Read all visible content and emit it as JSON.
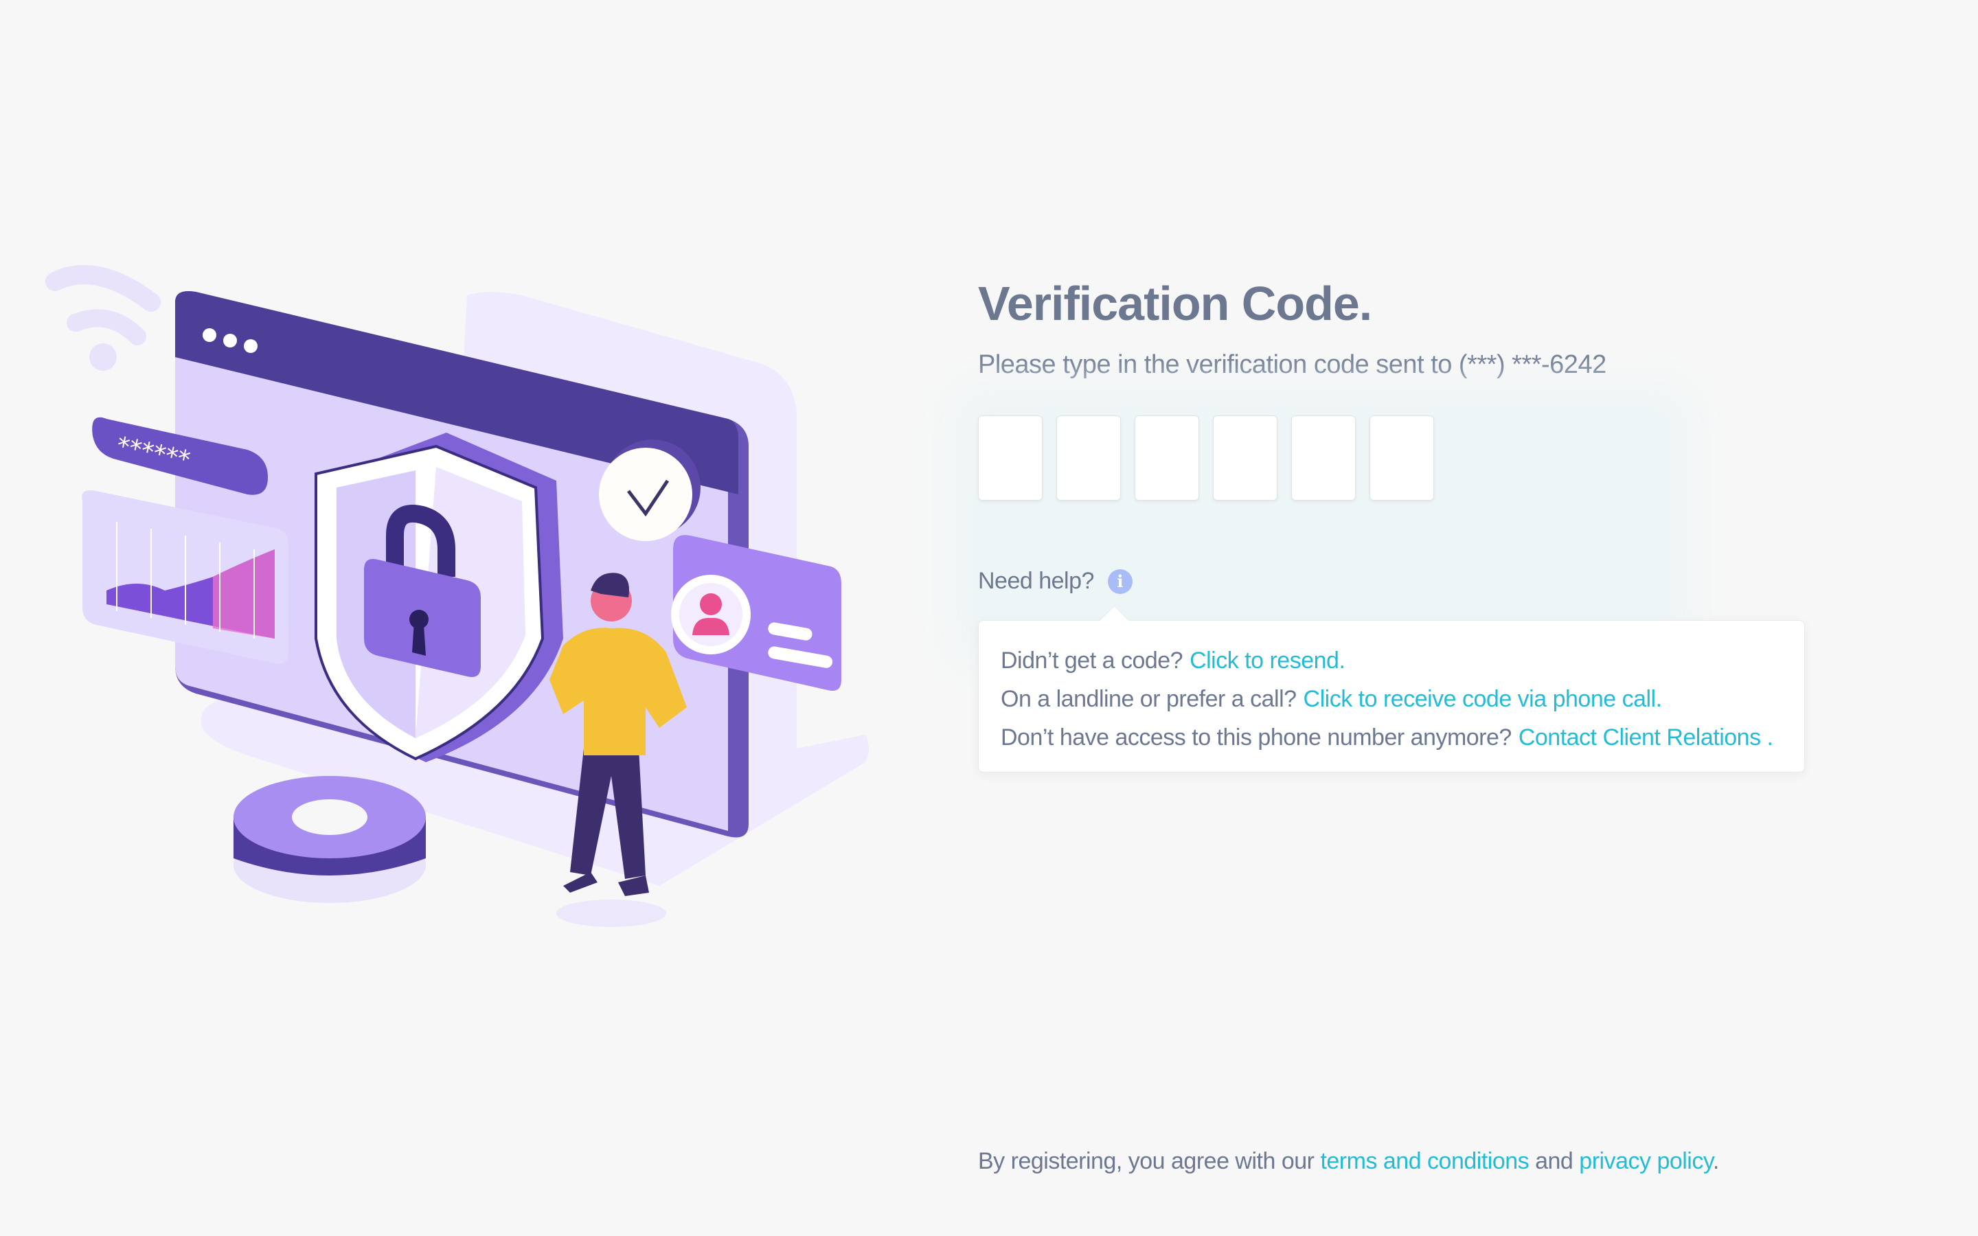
{
  "illustration": {
    "password_mask": "******",
    "icons": [
      "wifi-icon",
      "lock-icon",
      "shield-icon",
      "checkmark-icon",
      "user-icon",
      "gear-icon"
    ]
  },
  "verification": {
    "title": "Verification Code.",
    "subtitle": "Please type in the verification code sent to (***) ***-6242",
    "code_length": 6
  },
  "help": {
    "label": "Need help?",
    "info_icon": "i",
    "lines": [
      {
        "text": "Didn’t get a code?",
        "link": "Click to resend."
      },
      {
        "text": "On a landline or prefer a call?",
        "link": "Click to receive code via phone call."
      },
      {
        "text": "Don’t have access to this phone number anymore?",
        "link": "Contact Client Relations ."
      }
    ]
  },
  "footer": {
    "prefix": "By registering, you agree with our ",
    "terms_link": "terms and conditions",
    "middle": " and ",
    "privacy_link": "privacy policy",
    "suffix": "."
  },
  "colors": {
    "background": "#f7f7f7",
    "text": "#6b7890",
    "link": "#22bcd6",
    "accent_purple": "#7b5ce0"
  }
}
